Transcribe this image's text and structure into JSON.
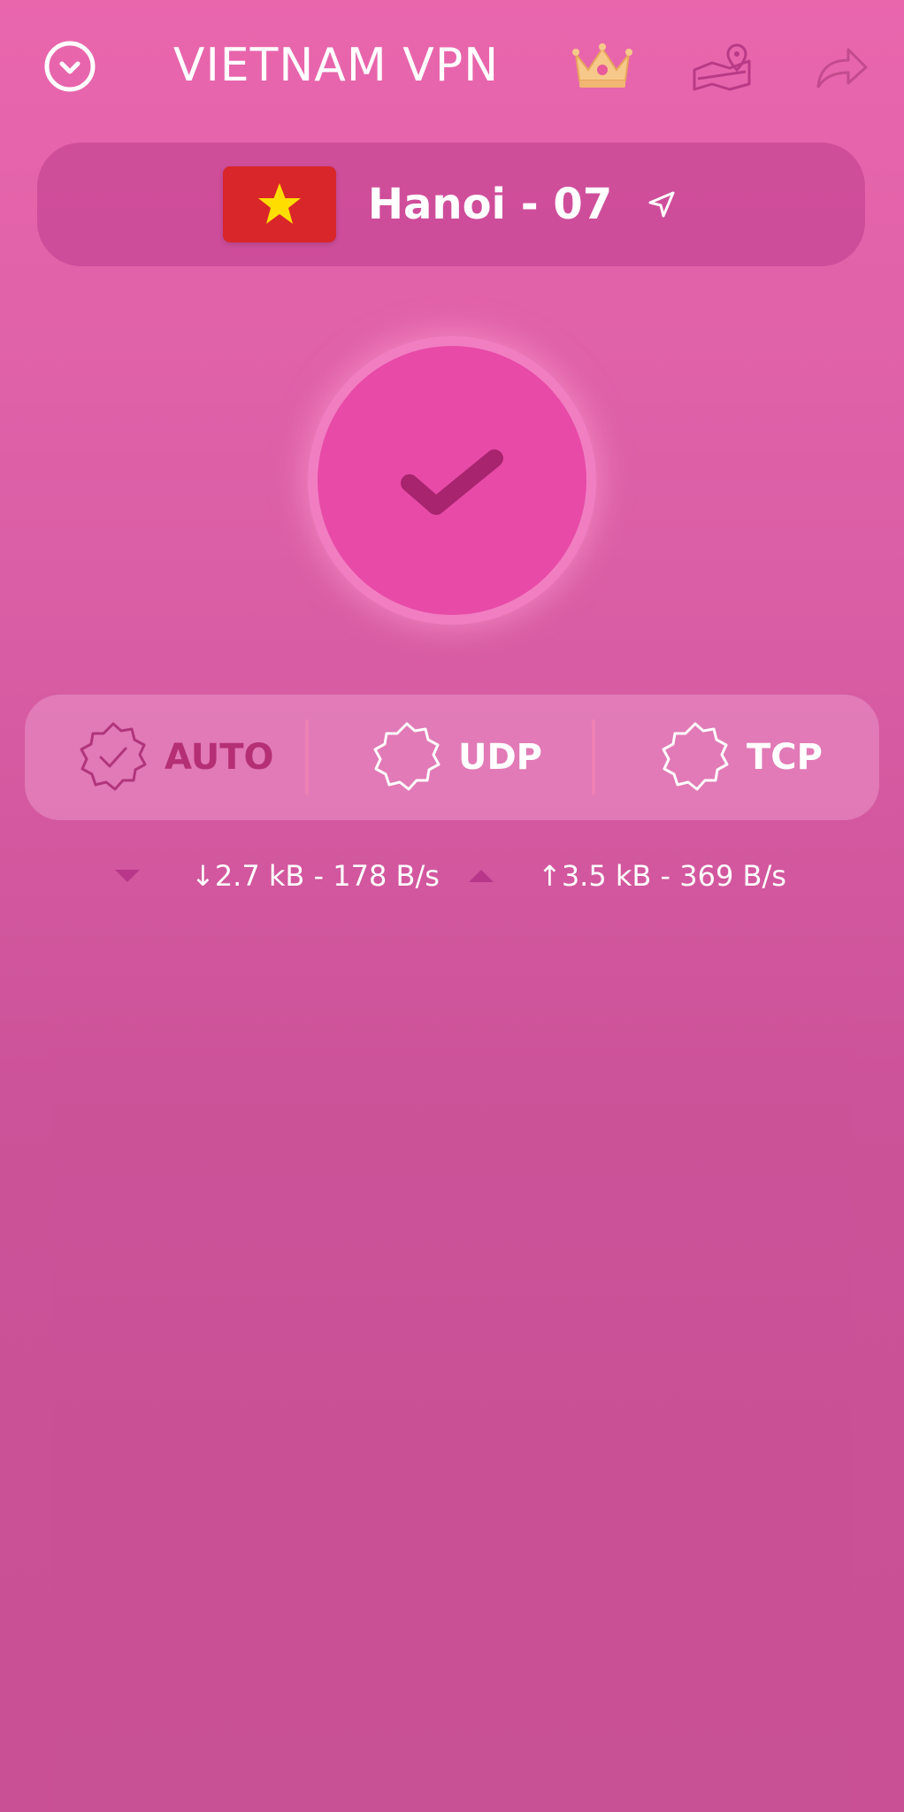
{
  "header": {
    "title": "VIETNAM VPN",
    "icons": {
      "menu": "chevron-down-circle-icon",
      "premium": "crown-icon",
      "map": "map-pin-icon",
      "share": "share-icon"
    }
  },
  "server": {
    "name": "Hanoi - 07",
    "flag": "vietnam-flag",
    "flag_colors": {
      "field": "#d9262a",
      "star": "#ffdd00"
    }
  },
  "connection": {
    "status": "connected",
    "icon": "checkmark-icon"
  },
  "protocols": [
    {
      "label": "AUTO",
      "selected": true,
      "color": "#b52f75"
    },
    {
      "label": "UDP",
      "selected": false,
      "color": "#ffffff"
    },
    {
      "label": "TCP",
      "selected": false,
      "color": "#ffffff"
    }
  ],
  "traffic": {
    "download": "↓2.7 kB - 178 B/s",
    "upload": "↑3.5 kB - 369 B/s"
  },
  "colors": {
    "background": "#e966ad",
    "button": "#e74aa7",
    "accent": "#b52f75"
  }
}
